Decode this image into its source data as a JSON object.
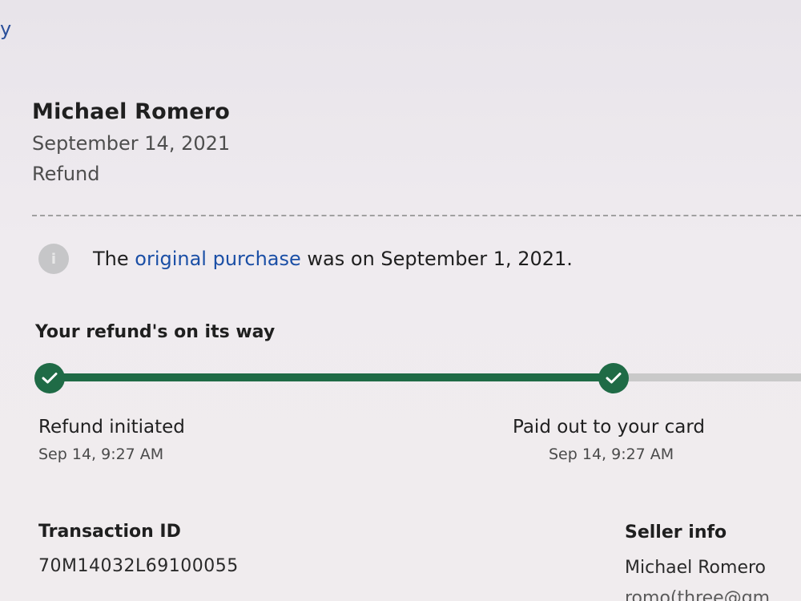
{
  "back_link": {
    "label": "y"
  },
  "header": {
    "name": "Michael Romero",
    "date": "September 14, 2021",
    "type": "Refund"
  },
  "notice": {
    "prefix": "The ",
    "link_text": "original purchase",
    "suffix": " was on September 1, 2021."
  },
  "progress": {
    "title": "Your refund's on its way",
    "completed_fraction": 0.75,
    "steps": [
      {
        "label": "Refund initiated",
        "time": "Sep 14, 9:27 AM"
      },
      {
        "label": "Paid out to your card",
        "time": "Sep 14, 9:27 AM"
      }
    ]
  },
  "transaction": {
    "id_label": "Transaction ID",
    "id_value": "70M14032L69100055"
  },
  "seller": {
    "label": "Seller info",
    "name": "Michael Romero",
    "email_partial": "romo(three@gm"
  },
  "colors": {
    "progress_green": "#1f6b46",
    "link_blue": "#1b4fa6"
  }
}
